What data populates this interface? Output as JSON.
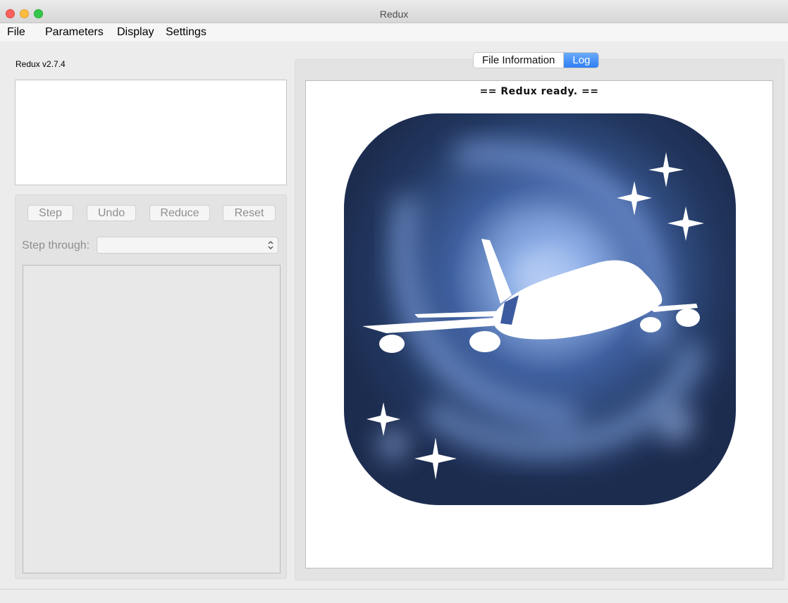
{
  "window": {
    "title": "Redux"
  },
  "menu": [
    "File",
    "Parameters",
    "Display",
    "Settings"
  ],
  "left": {
    "version": "Redux v2.7.4",
    "buttons": {
      "step": "Step",
      "undo": "Undo",
      "reduce": "Reduce",
      "reset": "Reset"
    },
    "step_through_label": "Step through:",
    "step_through_value": ""
  },
  "tabs": {
    "file_info": "File Information",
    "log": "Log",
    "active": "Log"
  },
  "log": {
    "message": "== Redux ready. =="
  },
  "logo": {
    "bg_dark": "#1e2f57",
    "bg_light": "#8eaee0",
    "fg": "#ffffff"
  }
}
